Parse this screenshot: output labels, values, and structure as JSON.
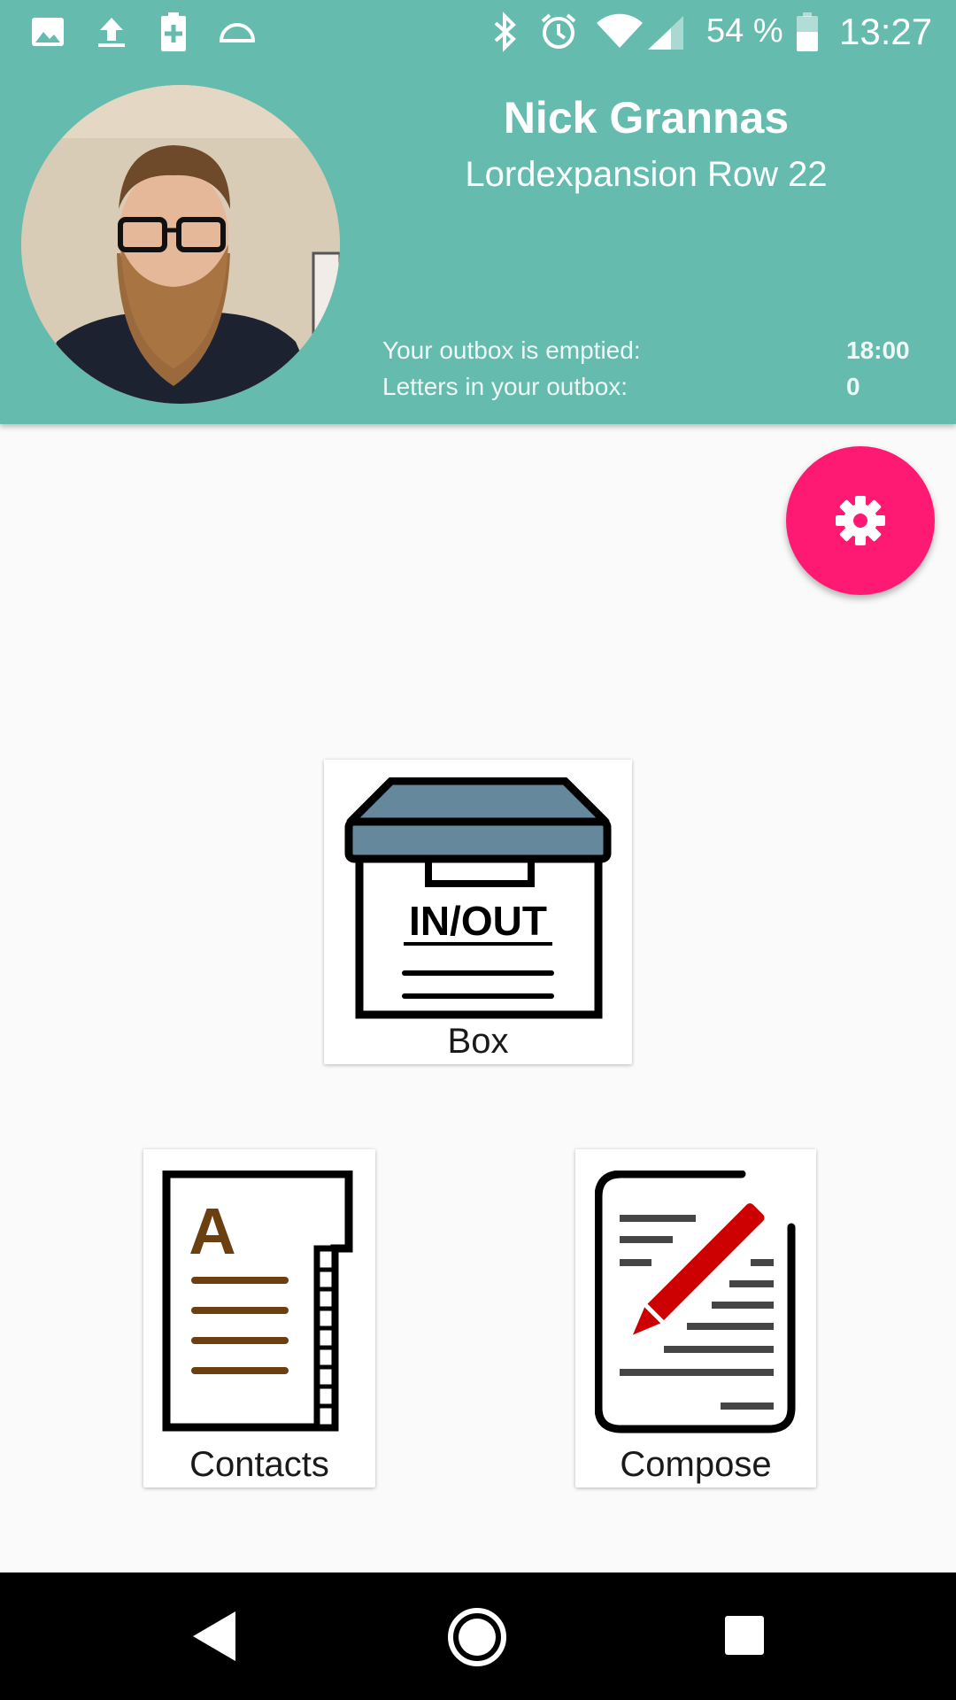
{
  "status_bar": {
    "battery_percent": "54 %",
    "time": "13:27",
    "left_icons": [
      "image-icon",
      "upload-icon",
      "battery-plus-icon",
      "half-circle-icon"
    ],
    "right_icons": [
      "bluetooth-icon",
      "alarm-icon",
      "wifi-icon",
      "signal-icon",
      "battery-icon"
    ]
  },
  "profile": {
    "name": "Nick Grannas",
    "address": "Lordexpansion Row 22",
    "outbox_emptied_label": "Your outbox is emptied:",
    "outbox_emptied_value": "18:00",
    "letters_label": "Letters in your outbox:",
    "letters_value": "0"
  },
  "fab": {
    "icon": "gear-icon",
    "color": "#fe1a72"
  },
  "tiles": {
    "box": {
      "label": "Box",
      "art_text": "IN/OUT",
      "icon": "in-out-box-icon"
    },
    "contacts": {
      "label": "Contacts",
      "art_letter": "A",
      "icon": "address-book-icon"
    },
    "compose": {
      "label": "Compose",
      "icon": "pencil-document-icon"
    }
  },
  "colors": {
    "header": "#64bbae",
    "accent": "#fe1a72",
    "navbar": "#000000"
  },
  "nav": {
    "back_icon": "back-triangle-icon",
    "home_icon": "home-circle-icon",
    "recents_icon": "recents-square-icon"
  }
}
